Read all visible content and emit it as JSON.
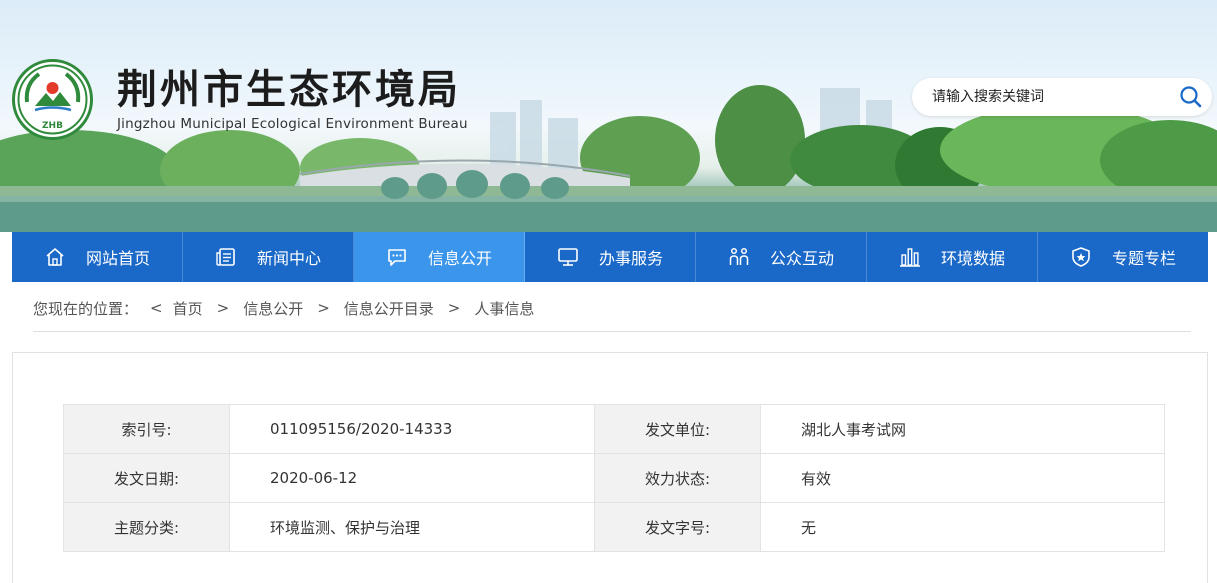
{
  "site": {
    "title": "荆州市生态环境局",
    "subtitle": "Jingzhou Municipal Ecological Environment Bureau",
    "logo_text": "ZHB"
  },
  "search": {
    "placeholder": "请输入搜索关键词",
    "icon": "search-icon"
  },
  "nav": {
    "items": [
      {
        "label": "网站首页",
        "icon": "home-icon"
      },
      {
        "label": "新闻中心",
        "icon": "news-icon"
      },
      {
        "label": "信息公开",
        "icon": "chat-icon",
        "active": true
      },
      {
        "label": "办事服务",
        "icon": "monitor-icon"
      },
      {
        "label": "公众互动",
        "icon": "people-icon"
      },
      {
        "label": "环境数据",
        "icon": "bar-chart-icon"
      },
      {
        "label": "专题专栏",
        "icon": "shield-star-icon"
      }
    ]
  },
  "breadcrumb": {
    "prefix": "您现在的位置：",
    "first_sep": "<",
    "sep": ">",
    "items": [
      "首页",
      "信息公开",
      "信息公开目录",
      "人事信息"
    ]
  },
  "meta": {
    "rows": [
      {
        "label1": "索引号:",
        "value1": "011095156/2020-14333",
        "label2": "发文单位:",
        "value2": "湖北人事考试网"
      },
      {
        "label1": "发文日期:",
        "value1": "2020-06-12",
        "label2": "效力状态:",
        "value2": "有效"
      },
      {
        "label1": "主题分类:",
        "value1": "环境监测、保护与治理",
        "label2": "发文字号:",
        "value2": "无"
      }
    ]
  },
  "colors": {
    "nav_bg": "#1a68c8",
    "nav_active": "#3b95ea",
    "label_bg": "#f2f2f2"
  }
}
